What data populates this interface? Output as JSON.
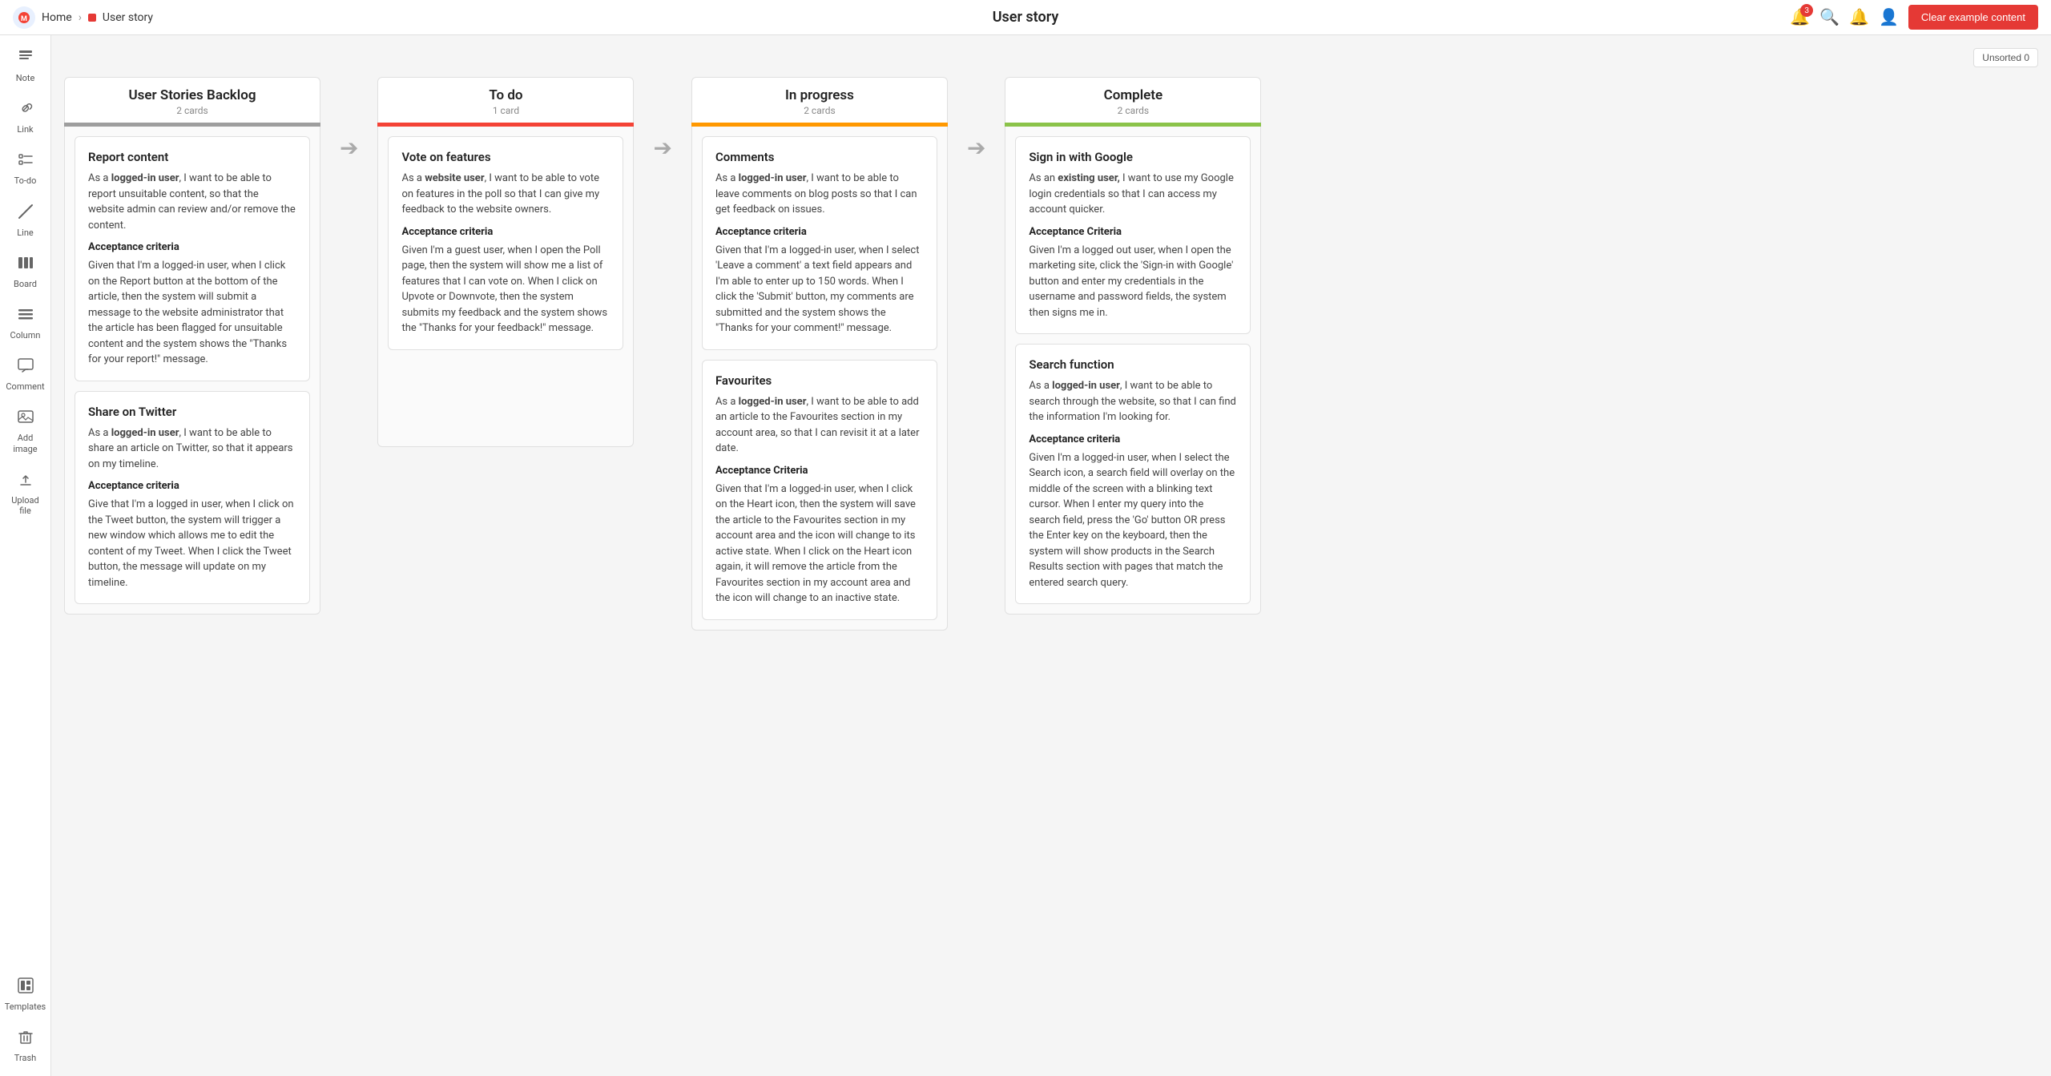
{
  "topbar": {
    "home_label": "Home",
    "page_title": "User story",
    "breadcrumb_item": "User story",
    "clear_btn": "Clear example content",
    "badge_count": "3"
  },
  "sidebar": {
    "items": [
      {
        "id": "note",
        "label": "Note",
        "icon": "📝"
      },
      {
        "id": "link",
        "label": "Link",
        "icon": "🔗"
      },
      {
        "id": "todo",
        "label": "To-do",
        "icon": "☑️"
      },
      {
        "id": "line",
        "label": "Line",
        "icon": "✏️"
      },
      {
        "id": "board",
        "label": "Board",
        "icon": "⊞"
      },
      {
        "id": "column",
        "label": "Column",
        "icon": "☰"
      },
      {
        "id": "comment",
        "label": "Comment",
        "icon": "💬"
      },
      {
        "id": "add-image",
        "label": "Add image",
        "icon": "🖼️"
      },
      {
        "id": "upload-file",
        "label": "Upload file",
        "icon": "⬆️"
      },
      {
        "id": "templates",
        "label": "Templates",
        "icon": "⊟"
      },
      {
        "id": "trash",
        "label": "Trash",
        "icon": "🗑️"
      }
    ]
  },
  "board": {
    "unsorted_label": "Unsorted 0",
    "columns": [
      {
        "id": "backlog",
        "title": "User Stories Backlog",
        "count": "2 cards",
        "bar_color": "#9e9e9e",
        "css_class": "col-backlog",
        "cards": [
          {
            "title": "Report content",
            "desc_html": "As a <b>logged-in user</b>, I want to be able to report unsuitable content, so that the website admin can review and/or remove the content.",
            "criteria_title": "Acceptance criteria",
            "criteria_html": "Given that I'm a logged-in user, when I click on the Report button at the bottom of the article, then the system will submit a message to the website administrator that the article has been flagged for unsuitable content and the  system shows the \"Thanks for your report!\" message."
          },
          {
            "title": "Share on Twitter",
            "desc_html": "As a <b>logged-in user</b>, I want to be able to share an article on Twitter, so that it appears on my timeline.",
            "criteria_title": "Acceptance criteria",
            "criteria_html": "Give that I'm a logged in user, when I click on the Tweet button, the system will trigger a new window which allows me to edit the content of my Tweet. When I click the Tweet button, the message will update on my timeline."
          }
        ]
      },
      {
        "id": "todo",
        "title": "To do",
        "count": "1 card",
        "bar_color": "#f44336",
        "css_class": "col-todo",
        "cards": [
          {
            "title": "Vote on features",
            "desc_html": "As a <b>website user</b>, I want to be able to vote on features in the poll so that I can give my feedback to the website owners.",
            "criteria_title": "Acceptance criteria",
            "criteria_html": "Given I'm a guest user, when I open the Poll page, then the system will show me a list of features that I can vote on. When I click on Upvote or Downvote, then the system submits my feedback and the system shows the \"Thanks for your feedback!\" message."
          }
        ]
      },
      {
        "id": "inprogress",
        "title": "In progress",
        "count": "2 cards",
        "bar_color": "#ff9800",
        "css_class": "col-inprogress",
        "cards": [
          {
            "title": "Comments",
            "desc_html": "As a <b>logged-in user</b>, I want to be able to leave comments on blog posts so that I can get feedback on issues.",
            "criteria_title": "Acceptance criteria",
            "criteria_html": "Given that I'm a logged-in user, when I select 'Leave a comment' a text field appears and I'm able to enter up to 150 words. When I click the 'Submit' button, my comments are submitted and the system shows the \"Thanks for your comment!\" message."
          },
          {
            "title": "Favourites",
            "desc_html": "As a <b>logged-in user</b>, I want to be able to add an article to the Favourites section in my account area, so that I can revisit it at a later date.",
            "criteria_title": "Acceptance Criteria",
            "criteria_html": "Given that I'm a logged-in user, when I click on the Heart icon, then the system will save the article to the Favourites section in my account area and the icon will change to its active state. When I click on the Heart icon again, it will remove the article from the Favourites section in my account area and the icon will change to an inactive state."
          }
        ]
      },
      {
        "id": "complete",
        "title": "Complete",
        "count": "2 cards",
        "bar_color": "#8bc34a",
        "css_class": "col-complete",
        "cards": [
          {
            "title": "Sign in with Google",
            "desc_html": "As an <b>existing user,</b> I want to use my Google login credentials so that I can access my account quicker.",
            "criteria_title": "Acceptance Criteria",
            "criteria_html": "Given I'm a logged out user, when I open the marketing site, click the 'Sign-in with Google' button and enter my credentials in the username and password fields, the system then signs me in."
          },
          {
            "title": "Search function",
            "desc_html": "As a <b>logged-in user</b>, I want to be able to search through the website, so that I can find the information I'm looking for.",
            "criteria_title": "Acceptance criteria",
            "criteria_html": "Given I'm a logged-in user, when I select the Search icon, a search field will overlay on the middle of the screen with a blinking text cursor. When I enter my query into the search field, press the 'Go' button OR press the Enter key on the keyboard, then the system will show products in the Search Results section with pages that match the entered search query."
          }
        ]
      }
    ]
  }
}
